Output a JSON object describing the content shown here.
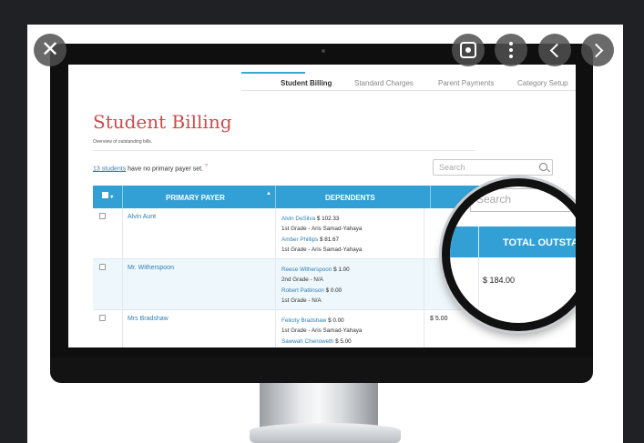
{
  "viewer": {
    "close_icon": "close-icon",
    "lens_icon": "lens-icon",
    "more_icon": "more-vert-icon",
    "prev_icon": "chevron-left-icon",
    "next_icon": "chevron-right-icon"
  },
  "tabs": [
    {
      "label": "Student Billing",
      "active": true
    },
    {
      "label": "Standard Charges",
      "active": false
    },
    {
      "label": "Parent Payments",
      "active": false
    },
    {
      "label": "Category Setup",
      "active": false
    }
  ],
  "page": {
    "title": "Student Billing",
    "subtitle": "Overview of outstanding bills.",
    "notice_link": "13 students",
    "notice_text": " have no primary payer set.",
    "notice_help": "?"
  },
  "search": {
    "placeholder": "Search"
  },
  "table": {
    "columns": {
      "primary_payer": "PRIMARY PAYER",
      "dependents": "DEPENDENTS",
      "total_outstanding": "TOTAL OUTSTAN"
    },
    "rows": [
      {
        "payer": "Alvin Aunt",
        "dependents": [
          {
            "name": "Alvin DeSilva",
            "amount": "$ 102.33",
            "grade": "1st Grade - Aris Samad-Yahaya"
          },
          {
            "name": "Amber Phillips",
            "amount": "$ 81.67",
            "grade": "1st Grade - Aris Samad-Yahaya"
          }
        ],
        "total": "$ 184.00"
      },
      {
        "payer": "Mr. Witherspoon",
        "dependents": [
          {
            "name": "Reese Witherspoon",
            "amount": "$ 1.00",
            "grade": "2nd Grade - N/A"
          },
          {
            "name": "Robert Pattinson",
            "amount": "$ 0.00",
            "grade": "1st Grade - N/A"
          }
        ],
        "total": ""
      },
      {
        "payer": "Mrs Bradshaw",
        "dependents": [
          {
            "name": "Felicity Bradshaw",
            "amount": "$ 0.00",
            "grade": "1st Grade - Aris Samad-Yahaya"
          },
          {
            "name": "Sawwah Chenoweth",
            "amount": "$ 5.00",
            "grade": ""
          }
        ],
        "total": "$ 5.00"
      }
    ]
  },
  "colors": {
    "accent": "#32a0d4",
    "title_red": "#d0484c",
    "link_blue": "#2f7fb6"
  }
}
